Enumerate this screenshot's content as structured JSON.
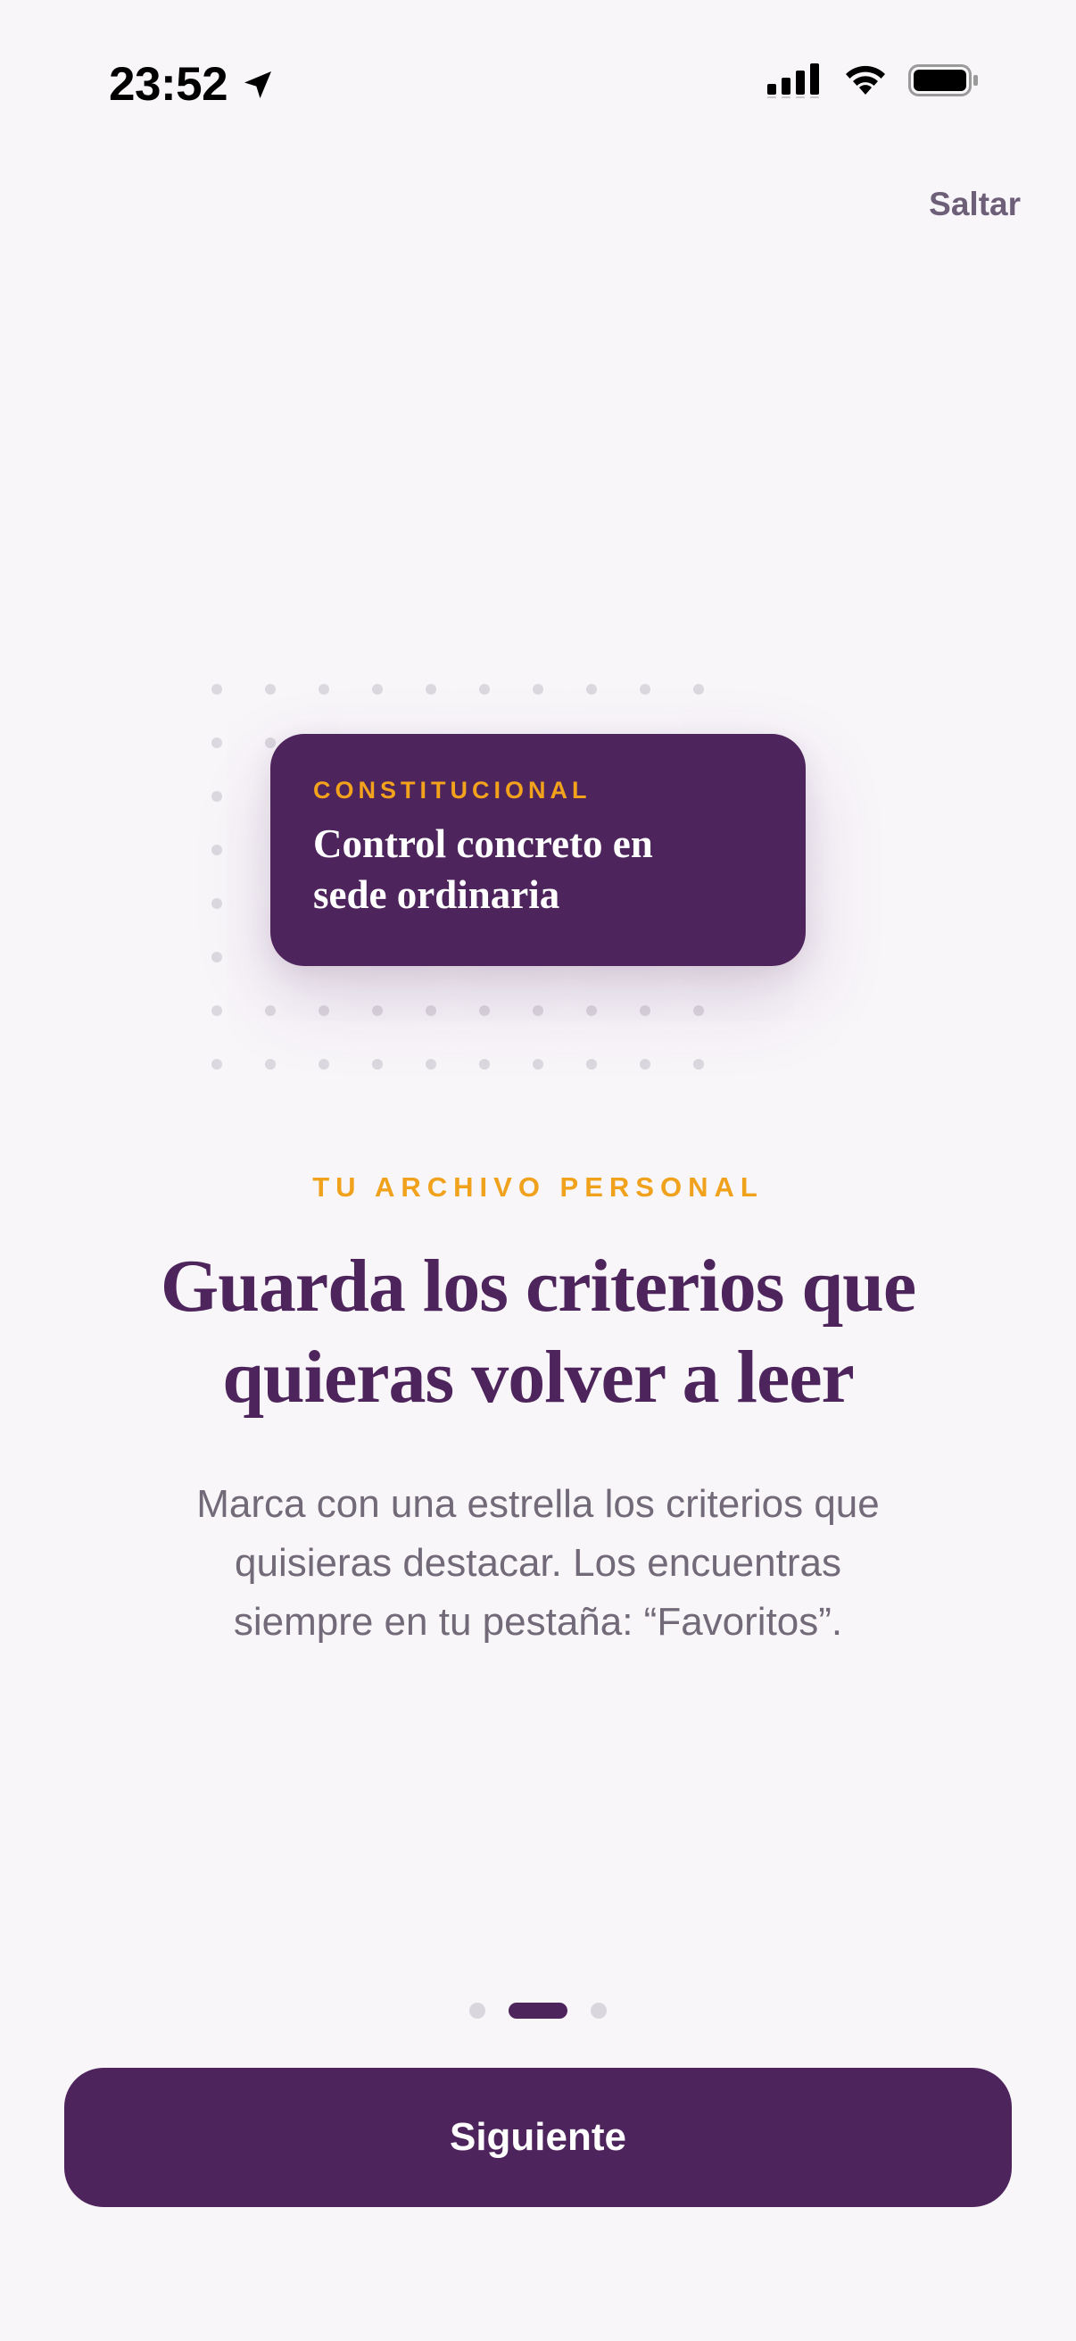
{
  "status_bar": {
    "time": "23:52",
    "icons": [
      "location-arrow-icon",
      "cellular-signal-icon",
      "wifi-icon",
      "battery-icon"
    ]
  },
  "skip_label": "Saltar",
  "illustration": {
    "card_category": "CONSTITUCIONAL",
    "card_title_line1": "Control concreto en",
    "card_title_line2": "sede ordinaria"
  },
  "eyebrow": "TU ARCHIVO PERSONAL",
  "headline": {
    "line1": "Guarda los criterios que",
    "line2": "quieras volver a leer"
  },
  "body": {
    "line1": "Marca con una estrella los criterios que",
    "line2": "quisieras destacar. Los encuentras",
    "line3": "siempre en tu pestaña: “Favoritos”."
  },
  "pager": {
    "count": 3,
    "active_index": 1
  },
  "next_button_label": "Siguiente",
  "colors": {
    "primary": "#4e245c",
    "accent": "#f0a21d",
    "background": "#f9f6fa",
    "muted_text": "#726a78"
  }
}
